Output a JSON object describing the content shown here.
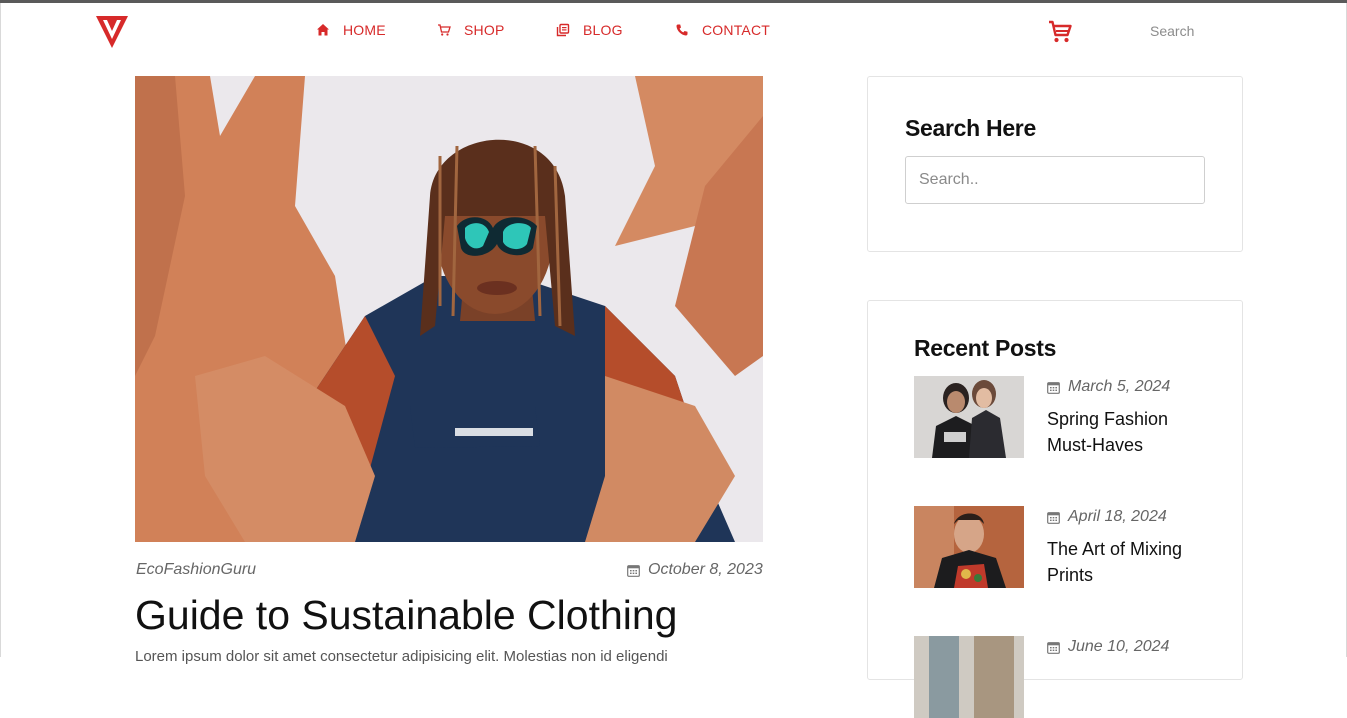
{
  "nav": {
    "items": [
      {
        "label": "HOME",
        "icon": "home-icon"
      },
      {
        "label": "SHOP",
        "icon": "cart-icon"
      },
      {
        "label": "BLOG",
        "icon": "blog-icon"
      },
      {
        "label": "CONTACT",
        "icon": "phone-icon"
      }
    ],
    "search_placeholder": "Search",
    "accent_color": "#d72a2a"
  },
  "article": {
    "author": "EcoFashionGuru",
    "date": "October 8, 2023",
    "title": "Guide to Sustainable Clothing",
    "excerpt": "Lorem ipsum dolor sit amet consectetur adipisicing elit. Molestias non id eligendi"
  },
  "sidebar": {
    "search": {
      "heading": "Search Here",
      "placeholder": "Search.."
    },
    "recent": {
      "heading": "Recent Posts",
      "posts": [
        {
          "date": "March 5, 2024",
          "title": "Spring Fashion Must-Haves"
        },
        {
          "date": "April 18, 2024",
          "title": "The Art of Mixing Prints"
        },
        {
          "date": "June 10, 2024",
          "title": ""
        }
      ]
    }
  }
}
